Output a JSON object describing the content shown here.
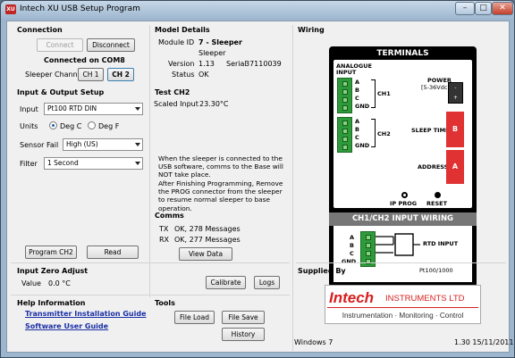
{
  "window": {
    "title": "Intech XU USB Setup Program",
    "icon_text": "XU",
    "minimize": "–",
    "maximize": "□",
    "close": "✕"
  },
  "connection": {
    "title": "Connection",
    "connect": "Connect",
    "disconnect": "Disconnect",
    "status": "Connected on COM8",
    "sleeper_channel_label": "Sleeper Channel",
    "ch1": "CH 1",
    "ch2": "CH 2"
  },
  "model": {
    "title": "Model Details",
    "module_id_label": "Module ID",
    "module_id": "7 - Sleeper",
    "module_name": "Sleeper",
    "version_label": "Version",
    "version": "1.13",
    "serial_label": "Serial",
    "serial": "37110039",
    "status_label": "Status",
    "status": "OK"
  },
  "io": {
    "title": "Input & Output Setup",
    "input_label": "Input",
    "input_value": "Pt100 RTD DIN",
    "units_label": "Units",
    "deg_c": "Deg C",
    "deg_f": "Deg F",
    "sensor_fail_label": "Sensor Fail",
    "sensor_fail_value": "High (US)",
    "filter_label": "Filter",
    "filter_value": "1 Second",
    "program_btn": "Program CH2",
    "read_btn": "Read"
  },
  "test": {
    "title": "Test CH2",
    "scaled_label": "Scaled Input",
    "scaled_value": "23.30°C",
    "note1": "When the sleeper is connected to the USB software, comms to the Base will NOT take place.",
    "note2": "After Finishing Programming, Remove the PROG connector from the sleeper to resume normal sleeper to base operation."
  },
  "comms": {
    "title": "Comms",
    "tx_label": "TX",
    "tx_value": "OK, 278 Messages",
    "rx_label": "RX",
    "rx_value": "OK, 277 Messages",
    "view_btn": "View Data"
  },
  "zero": {
    "title": "Input Zero Adjust",
    "value_label": "Value",
    "value": "0.0 °C",
    "calibrate": "Calibrate",
    "logs": "Logs"
  },
  "help": {
    "title": "Help Information",
    "link1": "Transmitter Installation Guide",
    "link2": "Software User Guide"
  },
  "tools": {
    "title": "Tools",
    "file_load": "File Load",
    "file_save": "File Save",
    "history": "History"
  },
  "wiring": {
    "title": "Wiring",
    "terminals": "TERMINALS",
    "analogue_input": "ANALOGUE INPUT",
    "pins": [
      "A",
      "B",
      "C",
      "GND"
    ],
    "ch1": "CH1",
    "ch2": "CH2",
    "power": "POWER",
    "power_spec": "[5-36Vdc]",
    "sleep_time": "SLEEP TIME",
    "address": "ADDRESS",
    "b_label": "B",
    "a_label": "A",
    "ip_prog": "IP PROG",
    "reset": "RESET",
    "input_wiring": "CH1/CH2 INPUT WIRING",
    "rtd_input": "RTD INPUT",
    "sensor_type": "Pt100/1000",
    "power_minus": "-",
    "power_plus": "+"
  },
  "supplied": {
    "title": "Supplied By",
    "brand": "Intech",
    "brand_suffix": "INSTRUMENTS LTD",
    "tagline": "Instrumentation · Monitoring · Control"
  },
  "footer": {
    "os": "Windows 7",
    "version": "1.30 15/11/2011"
  },
  "colors": {
    "accent_red": "#e03232",
    "link_blue": "#1a2fa6",
    "terminal_green": "#2f9a3b"
  }
}
